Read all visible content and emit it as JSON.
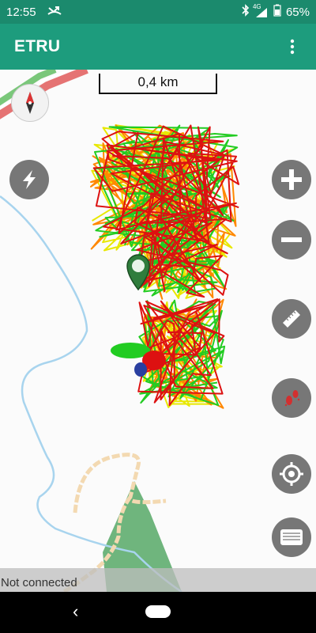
{
  "status_bar": {
    "time": "12:55",
    "network": "4G",
    "battery": "65%",
    "icons": [
      "missed-call-icon",
      "bluetooth-icon",
      "signal-icon",
      "battery-icon"
    ]
  },
  "app_bar": {
    "title": "ETRU",
    "menu_icon": "more-vert-icon"
  },
  "map": {
    "scale_label": "0,4 km",
    "compass_icon": "compass-icon",
    "left_buttons": [
      {
        "name": "lightning-button",
        "icon": "lightning-icon"
      }
    ],
    "right_buttons": [
      {
        "name": "zoom-in-button",
        "icon": "plus-icon"
      },
      {
        "name": "zoom-out-button",
        "icon": "minus-icon"
      },
      {
        "name": "measure-button",
        "icon": "ruler-icon"
      },
      {
        "name": "tracks-button",
        "icon": "footprints-icon"
      },
      {
        "name": "locate-button",
        "icon": "crosshair-icon"
      },
      {
        "name": "keyboard-button",
        "icon": "keyboard-icon"
      }
    ],
    "track_colors": [
      "#e8e800",
      "#ff8800",
      "#22cc22",
      "#dd1111"
    ]
  },
  "footer": {
    "connection_status": "Not connected"
  },
  "nav": {
    "back_icon": "back-icon",
    "home_icon": "home-pill-icon"
  },
  "colors": {
    "status_bar": "#1b8a6d",
    "app_bar": "#1d9c7d",
    "button_gray": "#777777"
  }
}
